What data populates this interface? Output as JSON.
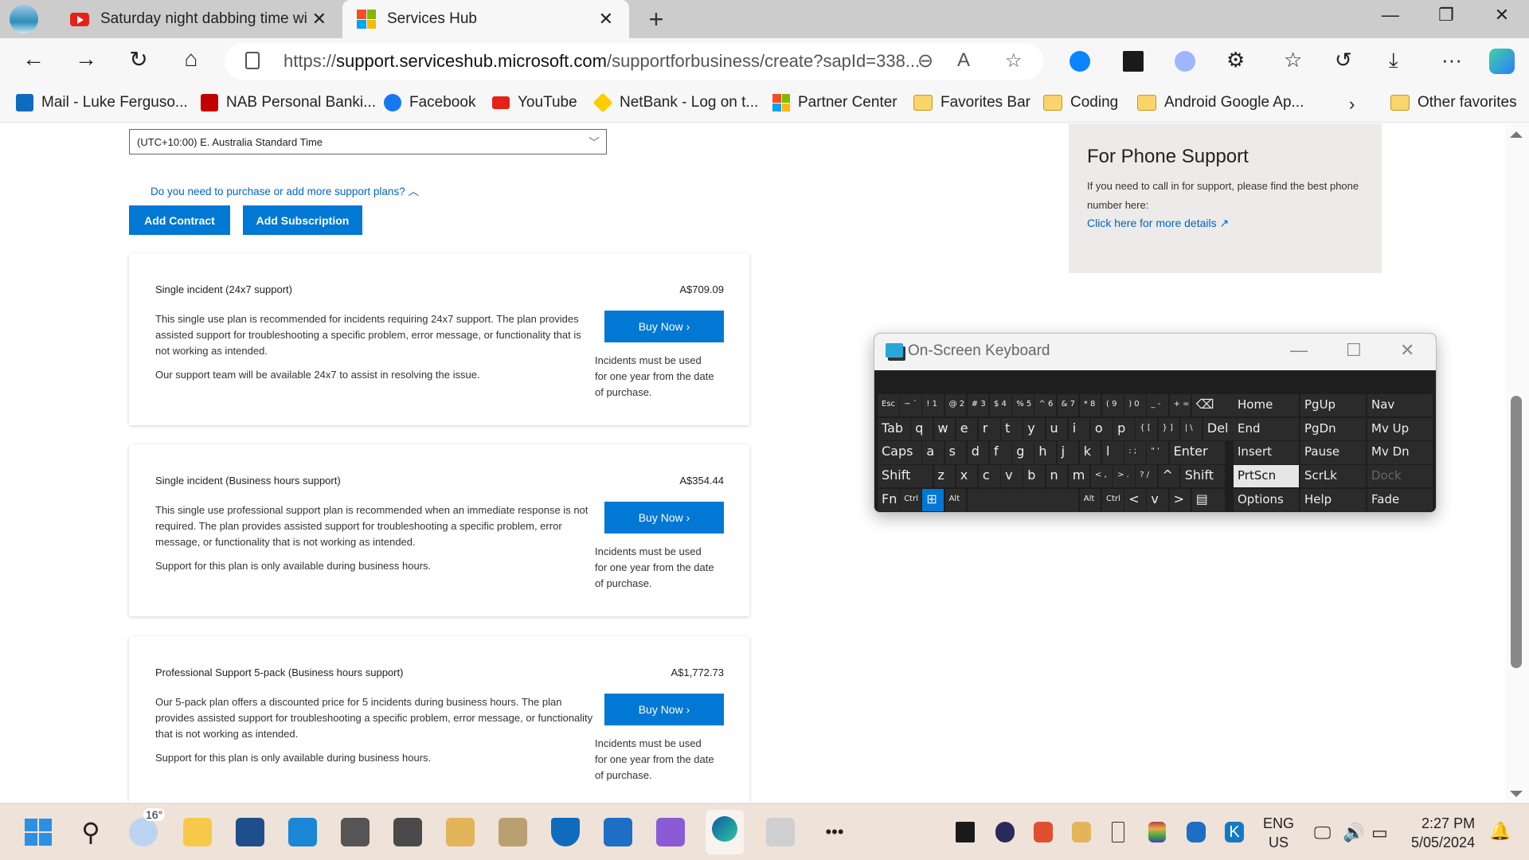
{
  "browser": {
    "tabs": [
      {
        "title": "Saturday night dabbing time with",
        "icon": "youtube-icon",
        "active": false
      },
      {
        "title": "Services Hub",
        "icon": "microsoft-icon",
        "active": true
      }
    ],
    "new_tab": "+",
    "window_controls": {
      "minimize": "—",
      "restore": "❐",
      "close": "✕"
    },
    "url_prefix": "https://",
    "url_host": "support.serviceshub.microsoft.com",
    "url_path": "/supportforbusiness/create?sapId=338...",
    "toolbar_icons": [
      "back-icon",
      "forward-icon",
      "refresh-icon",
      "home-icon",
      "lock-icon",
      "zoom-out-icon",
      "read-aloud-icon",
      "favorite-star-icon",
      "shazam-extension-icon",
      "nvidia-extension-icon",
      "search-extension-icon",
      "extensions-icon",
      "favorites-icon",
      "history-icon",
      "downloads-icon",
      "more-icon",
      "copilot-icon"
    ],
    "bookmarks": [
      {
        "label": "Mail - Luke Ferguso...",
        "icon": "outlook-icon",
        "color": "#0f6cbd"
      },
      {
        "label": "NAB Personal Banki...",
        "icon": "nab-icon",
        "color": "#c20000"
      },
      {
        "label": "Facebook",
        "icon": "facebook-icon",
        "color": "#1877f2"
      },
      {
        "label": "YouTube",
        "icon": "youtube-icon",
        "color": "#e62117"
      },
      {
        "label": "NetBank - Log on t...",
        "icon": "commbank-icon",
        "color": "#ffcc00"
      },
      {
        "label": "Partner Center",
        "icon": "microsoft-icon",
        "color": "#f25022"
      },
      {
        "label": "Favorites Bar",
        "icon": "folder-icon"
      },
      {
        "label": "Coding",
        "icon": "folder-icon"
      },
      {
        "label": "Android Google Ap...",
        "icon": "folder-icon"
      }
    ],
    "bookmarks_more": "›",
    "other_favorites": "Other favorites"
  },
  "page": {
    "timezone_select": "(UTC+10:00) E. Australia Standard Time",
    "plans_link": "Do you need to purchase or add more support plans?",
    "add_contract": "Add Contract",
    "add_subscription": "Add Subscription",
    "plans": [
      {
        "title": "Single incident (24x7 support)",
        "price": "A$709.09",
        "desc1": "This single use plan is recommended for incidents requiring 24x7 support. The plan provides assisted support for troubleshooting a specific problem, error message, or functionality that is not working as intended.",
        "desc2": "Our support team will be available 24x7 to assist in resolving the issue.",
        "buy": "Buy Now ›",
        "note": "Incidents must be used for one year from the date of purchase."
      },
      {
        "title": "Single incident (Business hours support)",
        "price": "A$354.44",
        "desc1": "This single use professional support plan is recommended when an immediate response is not required. The plan provides assisted support for troubleshooting a specific problem, error message, or functionality that is not working as intended.",
        "desc2": "Support for this plan is only available during business hours.",
        "buy": "Buy Now ›",
        "note": "Incidents must be used for one year from the date of purchase."
      },
      {
        "title": "Professional Support 5-pack (Business hours support)",
        "price": "A$1,772.73",
        "desc1": "Our 5-pack plan offers a discounted price for 5 incidents during business hours. The plan provides assisted support for troubleshooting a specific problem, error message, or functionality that is not working as intended.",
        "desc2": "Support for this plan is only available during business hours.",
        "buy": "Buy Now ›",
        "note": "Incidents must be used for one year from the date of purchase."
      }
    ],
    "phone": {
      "title": "For Phone Support",
      "text": "If you need to call in for support, please find the best phone number here:",
      "link": "Click here for more details ↗"
    }
  },
  "osk": {
    "title": "On-Screen Keyboard",
    "rows": [
      [
        "Esc",
        "~ `",
        "! 1",
        "@ 2",
        "# 3",
        "$ 4",
        "% 5",
        "^ 6",
        "& 7",
        "* 8",
        "( 9",
        ") 0",
        "_ -",
        "+ =",
        "⌫"
      ],
      [
        "Tab",
        "q",
        "w",
        "e",
        "r",
        "t",
        "y",
        "u",
        "i",
        "o",
        "p",
        "{ [",
        "} ]",
        "| \\",
        "Del"
      ],
      [
        "Caps",
        "a",
        "s",
        "d",
        "f",
        "g",
        "h",
        "j",
        "k",
        "l",
        ": ;",
        "\" '",
        "Enter"
      ],
      [
        "Shift",
        "z",
        "x",
        "c",
        "v",
        "b",
        "n",
        "m",
        "< ,",
        "> .",
        "? /",
        "^",
        "Shift"
      ],
      [
        "Fn",
        "Ctrl",
        "⊞",
        "Alt",
        "",
        "Alt",
        "Ctrl",
        "<",
        "v",
        ">",
        "▤"
      ]
    ],
    "side": [
      [
        "Home",
        "PgUp",
        "Nav"
      ],
      [
        "End",
        "PgDn",
        "Mv Up"
      ],
      [
        "Insert",
        "Pause",
        "Mv Dn"
      ],
      [
        "PrtScn",
        "ScrLk",
        "Dock"
      ],
      [
        "Options",
        "Help",
        "Fade"
      ]
    ],
    "selected_key": "PrtScn",
    "disabled_key": "Dock"
  },
  "taskbar": {
    "apps": [
      "start-icon",
      "search-icon",
      "weather-icon",
      "file-explorer-icon",
      "store-icon",
      "mail-icon",
      "on-screen-keyboard-icon",
      "snipping-icon",
      "ccleaner-icon",
      "usb-tool-icon",
      "defender-icon",
      "media-player-icon",
      "visual-studio-icon",
      "edge-icon",
      "audio-icon",
      "more-icon"
    ],
    "weather_temp": "16°",
    "tray_icons": [
      "nvidia-icon",
      "creative-cloud-icon",
      "ccleaner-tray-icon",
      "cleaner-icon",
      "usb-icon",
      "battery-meter-icon",
      "network-tool-icon",
      "k-app-icon"
    ],
    "lang_top": "ENG",
    "lang_bottom": "US",
    "time": "2:27 PM",
    "date": "5/05/2024"
  }
}
